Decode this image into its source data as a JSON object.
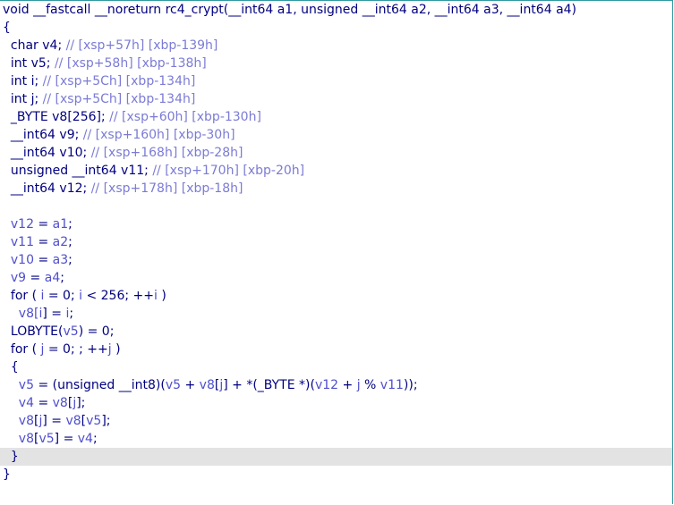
{
  "editor": {
    "accent_border_color": "#2e9aa0",
    "current_line_color": "#e3e3e3",
    "current_line_index": 25,
    "lines": [
      {
        "tokens": [
          {
            "t": "void __fastcall __noreturn rc4_crypt(__int64 a1, unsigned __int64 a2, __int64 a3, __int64 a4)",
            "c": "tx"
          }
        ]
      },
      {
        "tokens": [
          {
            "t": "{",
            "c": "op"
          }
        ]
      },
      {
        "tokens": [
          {
            "t": "  char v4; ",
            "c": "tx"
          },
          {
            "t": "// [xsp+57h] [xbp-139h]",
            "c": "cm"
          }
        ]
      },
      {
        "tokens": [
          {
            "t": "  int v5; ",
            "c": "tx"
          },
          {
            "t": "// [xsp+58h] [xbp-138h]",
            "c": "cm"
          }
        ]
      },
      {
        "tokens": [
          {
            "t": "  int i; ",
            "c": "tx"
          },
          {
            "t": "// [xsp+5Ch] [xbp-134h]",
            "c": "cm"
          }
        ]
      },
      {
        "tokens": [
          {
            "t": "  int j; ",
            "c": "tx"
          },
          {
            "t": "// [xsp+5Ch] [xbp-134h]",
            "c": "cm"
          }
        ]
      },
      {
        "tokens": [
          {
            "t": "  _BYTE v8[256]; ",
            "c": "tx"
          },
          {
            "t": "// [xsp+60h] [xbp-130h]",
            "c": "cm"
          }
        ]
      },
      {
        "tokens": [
          {
            "t": "  __int64 v9; ",
            "c": "tx"
          },
          {
            "t": "// [xsp+160h] [xbp-30h]",
            "c": "cm"
          }
        ]
      },
      {
        "tokens": [
          {
            "t": "  __int64 v10; ",
            "c": "tx"
          },
          {
            "t": "// [xsp+168h] [xbp-28h]",
            "c": "cm"
          }
        ]
      },
      {
        "tokens": [
          {
            "t": "  unsigned __int64 v11; ",
            "c": "tx"
          },
          {
            "t": "// [xsp+170h] [xbp-20h]",
            "c": "cm"
          }
        ]
      },
      {
        "tokens": [
          {
            "t": "  __int64 v12; ",
            "c": "tx"
          },
          {
            "t": "// [xsp+178h] [xbp-18h]",
            "c": "cm"
          }
        ]
      },
      {
        "tokens": []
      },
      {
        "tokens": [
          {
            "t": "  v12",
            "c": "var"
          },
          {
            "t": " = ",
            "c": "op"
          },
          {
            "t": "a1",
            "c": "var"
          },
          {
            "t": ";",
            "c": "op"
          }
        ]
      },
      {
        "tokens": [
          {
            "t": "  v11",
            "c": "var"
          },
          {
            "t": " = ",
            "c": "op"
          },
          {
            "t": "a2",
            "c": "var"
          },
          {
            "t": ";",
            "c": "op"
          }
        ]
      },
      {
        "tokens": [
          {
            "t": "  v10",
            "c": "var"
          },
          {
            "t": " = ",
            "c": "op"
          },
          {
            "t": "a3",
            "c": "var"
          },
          {
            "t": ";",
            "c": "op"
          }
        ]
      },
      {
        "tokens": [
          {
            "t": "  v9",
            "c": "var"
          },
          {
            "t": " = ",
            "c": "op"
          },
          {
            "t": "a4",
            "c": "var"
          },
          {
            "t": ";",
            "c": "op"
          }
        ]
      },
      {
        "tokens": [
          {
            "t": "  for ( ",
            "c": "kw"
          },
          {
            "t": "i",
            "c": "var"
          },
          {
            "t": " = 0; ",
            "c": "op"
          },
          {
            "t": "i",
            "c": "var"
          },
          {
            "t": " < 256; ++",
            "c": "op"
          },
          {
            "t": "i",
            "c": "var"
          },
          {
            "t": " )",
            "c": "op"
          }
        ]
      },
      {
        "tokens": [
          {
            "t": "    v8[",
            "c": "var"
          },
          {
            "t": "i",
            "c": "var"
          },
          {
            "t": "] = ",
            "c": "op"
          },
          {
            "t": "i",
            "c": "var"
          },
          {
            "t": ";",
            "c": "op"
          }
        ]
      },
      {
        "tokens": [
          {
            "t": "  LOBYTE(",
            "c": "tx"
          },
          {
            "t": "v5",
            "c": "var"
          },
          {
            "t": ") = 0;",
            "c": "op"
          }
        ]
      },
      {
        "tokens": [
          {
            "t": "  for ( ",
            "c": "kw"
          },
          {
            "t": "j",
            "c": "var"
          },
          {
            "t": " = 0; ; ++",
            "c": "op"
          },
          {
            "t": "j",
            "c": "var"
          },
          {
            "t": " )",
            "c": "op"
          }
        ]
      },
      {
        "tokens": [
          {
            "t": "  {",
            "c": "op"
          }
        ]
      },
      {
        "tokens": [
          {
            "t": "    v5",
            "c": "var"
          },
          {
            "t": " = (unsigned __int8)(",
            "c": "op"
          },
          {
            "t": "v5",
            "c": "var"
          },
          {
            "t": " + ",
            "c": "op"
          },
          {
            "t": "v8",
            "c": "var"
          },
          {
            "t": "[",
            "c": "op"
          },
          {
            "t": "j",
            "c": "var"
          },
          {
            "t": "] + *(_BYTE *)(",
            "c": "op"
          },
          {
            "t": "v12",
            "c": "var"
          },
          {
            "t": " + ",
            "c": "op"
          },
          {
            "t": "j",
            "c": "var"
          },
          {
            "t": " % ",
            "c": "op"
          },
          {
            "t": "v11",
            "c": "var"
          },
          {
            "t": "));",
            "c": "op"
          }
        ]
      },
      {
        "tokens": [
          {
            "t": "    v4",
            "c": "var"
          },
          {
            "t": " = ",
            "c": "op"
          },
          {
            "t": "v8",
            "c": "var"
          },
          {
            "t": "[",
            "c": "op"
          },
          {
            "t": "j",
            "c": "var"
          },
          {
            "t": "];",
            "c": "op"
          }
        ]
      },
      {
        "tokens": [
          {
            "t": "    v8",
            "c": "var"
          },
          {
            "t": "[",
            "c": "op"
          },
          {
            "t": "j",
            "c": "var"
          },
          {
            "t": "] = ",
            "c": "op"
          },
          {
            "t": "v8",
            "c": "var"
          },
          {
            "t": "[",
            "c": "op"
          },
          {
            "t": "v5",
            "c": "var"
          },
          {
            "t": "];",
            "c": "op"
          }
        ]
      },
      {
        "tokens": [
          {
            "t": "    v8",
            "c": "var"
          },
          {
            "t": "[",
            "c": "op"
          },
          {
            "t": "v5",
            "c": "var"
          },
          {
            "t": "] = ",
            "c": "op"
          },
          {
            "t": "v4",
            "c": "var"
          },
          {
            "t": ";",
            "c": "op"
          }
        ]
      },
      {
        "tokens": [
          {
            "t": "  }",
            "c": "op"
          }
        ]
      },
      {
        "tokens": [
          {
            "t": "}",
            "c": "op"
          }
        ]
      }
    ]
  }
}
